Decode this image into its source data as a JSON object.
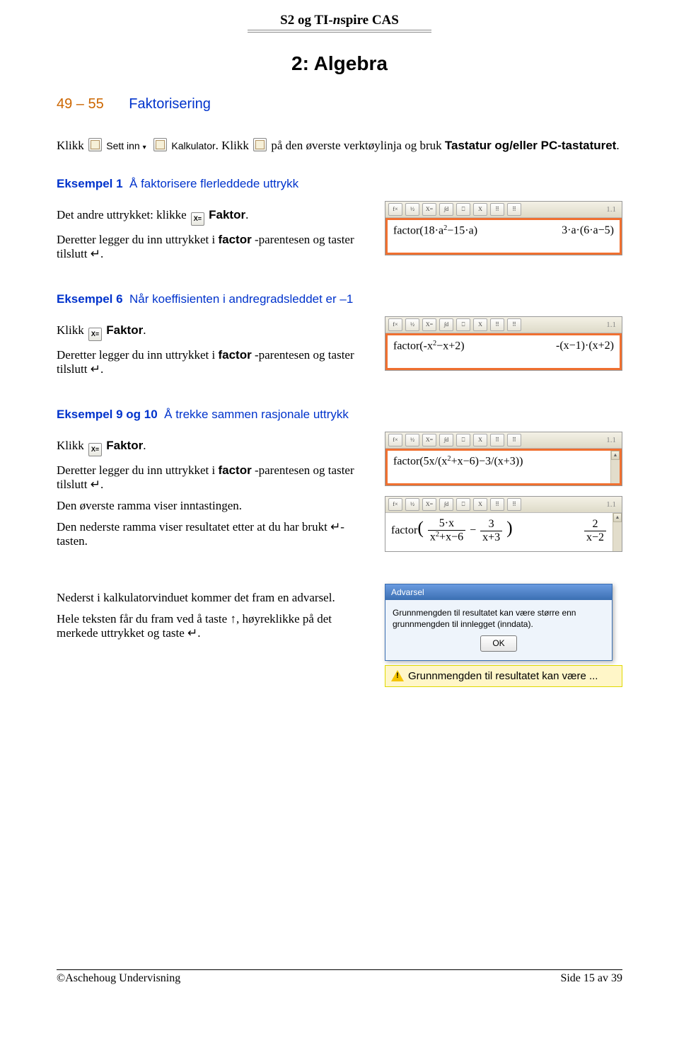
{
  "header": {
    "title_plain": "S2 og TI-",
    "title_italic": "n",
    "title_rest": "spire CAS"
  },
  "chapter": {
    "title": "2: Algebra"
  },
  "section": {
    "range": "49 – 55",
    "name": "Faktorisering"
  },
  "intro": {
    "klikk": "Klikk",
    "settinn": "Sett inn",
    "kalkulator": "Kalkulator",
    "dot": ". Klikk",
    "rest": " på den øverste verktøylinja og bruk",
    "tastatur": "Tastatur og/eller PC-tastaturet",
    "period": "."
  },
  "ex1": {
    "title_bold": "Eksempel 1",
    "title_rest": "Å faktorisere flerleddede uttrykk",
    "line1_a": "Det andre uttrykket: klikke",
    "faktor": "Faktor",
    "period": ".",
    "line2_a": "Deretter legger du inn uttrykket i",
    "factor_word": "factor",
    "line2_b": " -parentesen og taster tilslutt ↵.",
    "calc_left": "factor(18·a",
    "calc_left_sup": "2",
    "calc_left_rest": "−15·a)",
    "calc_right_a": "3·a·(6·a−5)",
    "tab": "1.1"
  },
  "ex6": {
    "title_bold": "Eksempel 6",
    "title_rest": "Når koeffisienten i andregradsleddet er –1",
    "klikk": "Klikk",
    "faktor": "Faktor",
    "period": ".",
    "line2_a": "Deretter legger du inn uttrykket i",
    "factor_word": "factor",
    "line2_b": " -parentesen og taster tilslutt ↵.",
    "calc_left_a": "factor(-x",
    "calc_left_sup": "2",
    "calc_left_b": "−x+2)",
    "calc_right": "-(x−1)·(x+2)",
    "tab": "1.1"
  },
  "ex9": {
    "title_bold": "Eksempel 9 og 10",
    "title_rest": "Å trekke sammen rasjonale uttrykk",
    "klikk": "Klikk",
    "faktor": "Faktor",
    "period": ".",
    "line2_a": "Deretter legger du inn uttrykket i",
    "factor_word": "factor",
    "line2_b": " -parentesen og taster tilslutt ↵.",
    "line3": "Den øverste ramma viser inntastingen.",
    "line4": "Den nederste ramma viser resultatet etter at du har brukt ↵-tasten.",
    "calcA_left": "factor(5x/(x",
    "calcA_sup": "2",
    "calcA_rest": "+x−6)−3/(x+3))",
    "tabA": "1.1",
    "calcB_before": "factor",
    "calcB_f1_num": "5·x",
    "calcB_f1_den_a": "x",
    "calcB_f1_den_sup": "2",
    "calcB_f1_den_b": "+x−6",
    "calcB_minus": "−",
    "calcB_f2_num": "3",
    "calcB_f2_den": "x+3",
    "calcB_r_num": "2",
    "calcB_r_den": "x−2",
    "tabB": "1.1"
  },
  "warning_block": {
    "line1": "Nederst i kalkulatorvinduet kommer det fram en advarsel.",
    "line2": "Hele teksten får du fram ved å taste ↑, høyreklikke på det merkede uttrykket og taste ↵.",
    "dialog_title": "Advarsel",
    "dialog_body": "Grunnmengden til resultatet kan være større enn grunnmengden til innlegget (inndata).",
    "ok": "OK",
    "bar_text": "Grunnmengden til resultatet kan være ..."
  },
  "footer": {
    "left": "©Aschehoug Undervisning",
    "right": "Side 15 av 39"
  }
}
